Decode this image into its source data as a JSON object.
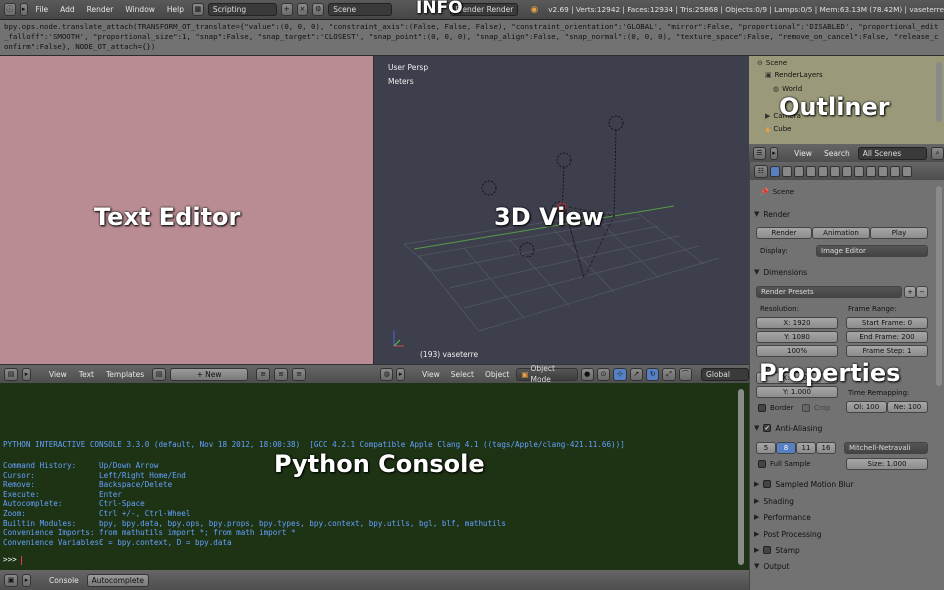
{
  "infobar": {
    "menus": [
      "File",
      "Add",
      "Render",
      "Window",
      "Help"
    ],
    "screen_layout": "Scripting",
    "scene": "Scene",
    "render_engine": "Blender Render",
    "stats": "v2.69 | Verts:12942 | Faces:12934 | Tris:25868 | Objects:0/9 | Lamps:0/5 | Mem:63.13M (78.42M) | vaseterre"
  },
  "info_log": "bpy.ops.node.translate_attach(TRANSFORM_OT_translate={\"value\":(0, 0, 0), \"constraint_axis\":(False, False, False), \"constraint_orientation\":'GLOBAL', \"mirror\":False, \"proportional\":'DISABLED', \"proportional_edit_falloff\":'SMOOTH', \"proportional_size\":1, \"snap\":False, \"snap_target\":'CLOSEST', \"snap_point\":(0, 0, 0), \"snap_align\":False, \"snap_normal\":(0, 0, 0), \"texture_space\":False, \"remove_on_cancel\":False, \"release_confirm\":False}, NODE_OT_attach={})",
  "overlays": {
    "info": "INFO",
    "text_editor": "Text Editor",
    "view3d": "3D View",
    "outliner": "Outliner",
    "properties": "Properties",
    "python_console": "Python Console"
  },
  "text_editor_footer": {
    "menus": [
      "View",
      "Text",
      "Templates"
    ],
    "new_button": "New"
  },
  "view3d": {
    "perspective_label": "User Persp",
    "units_label": "Meters",
    "object_label": "(193) vaseterre",
    "footer_menus": [
      "View",
      "Select",
      "Object"
    ],
    "mode": "Object Mode",
    "orientation": "Global"
  },
  "outliner": {
    "items": [
      "Scene",
      "RenderLayers",
      "World",
      "Camera",
      "Cube"
    ],
    "footer": {
      "view": "View",
      "search": "Search",
      "filter": "All Scenes"
    }
  },
  "properties": {
    "context_label": "Scene",
    "render": {
      "header": "Render",
      "render_button": "Render",
      "animation_button": "Animation",
      "play_button": "Play",
      "display_label": "Display:",
      "display_value": "Image Editor"
    },
    "dimensions": {
      "header": "Dimensions",
      "presets": "Render Presets",
      "resolution_label": "Resolution:",
      "res_x": "X: 1920",
      "res_y": "Y: 1080",
      "res_pct": "100%",
      "frame_range_label": "Frame Range:",
      "start_frame": "Start Frame: 0",
      "end_frame": "End Frame: 200",
      "frame_step": "Frame Step: 1",
      "aspect_x": "X: 1.000",
      "aspect_y": "Y: 1.000",
      "border": "Border",
      "crop": "Crop",
      "time_remap_label": "Time Remapping:",
      "old": "Ol: 100",
      "new": "Ne: 100"
    },
    "aa": {
      "header": "Anti-Aliasing",
      "samples": [
        "5",
        "8",
        "11",
        "16"
      ],
      "filter": "Mitchell-Netravali",
      "full_sample": "Full Sample",
      "size": "Size: 1.000"
    },
    "collapsed_panels": [
      "Sampled Motion Blur",
      "Shading",
      "Performance",
      "Post Processing",
      "Stamp"
    ],
    "output_header": "Output"
  },
  "console": {
    "banner": "PYTHON INTERACTIVE CONSOLE 3.3.0 (default, Nov 18 2012, 18:00:38)  [GCC 4.2.1 Compatible Apple Clang 4.1 ((tags/Apple/clang-421.11.66))]",
    "help": [
      {
        "k": "Command History:",
        "v": "Up/Down Arrow"
      },
      {
        "k": "Cursor:",
        "v": "Left/Right Home/End"
      },
      {
        "k": "Remove:",
        "v": "Backspace/Delete"
      },
      {
        "k": "Execute:",
        "v": "Enter"
      },
      {
        "k": "Autocomplete:",
        "v": "Ctrl-Space"
      },
      {
        "k": "Zoom:",
        "v": "Ctrl +/-, Ctrl-Wheel"
      },
      {
        "k": "Builtin Modules:",
        "v": "bpy, bpy.data, bpy.ops, bpy.props, bpy.types, bpy.context, bpy.utils, bgl, blf, mathutils"
      },
      {
        "k": "Convenience Imports:",
        "v": "from mathutils import *; from math import *"
      },
      {
        "k": "Convenience Variables:",
        "v": "C = bpy.context, D = bpy.data"
      }
    ],
    "prompt": ">>> ",
    "footer": {
      "console": "Console",
      "autocomplete": "Autocomplete"
    }
  }
}
